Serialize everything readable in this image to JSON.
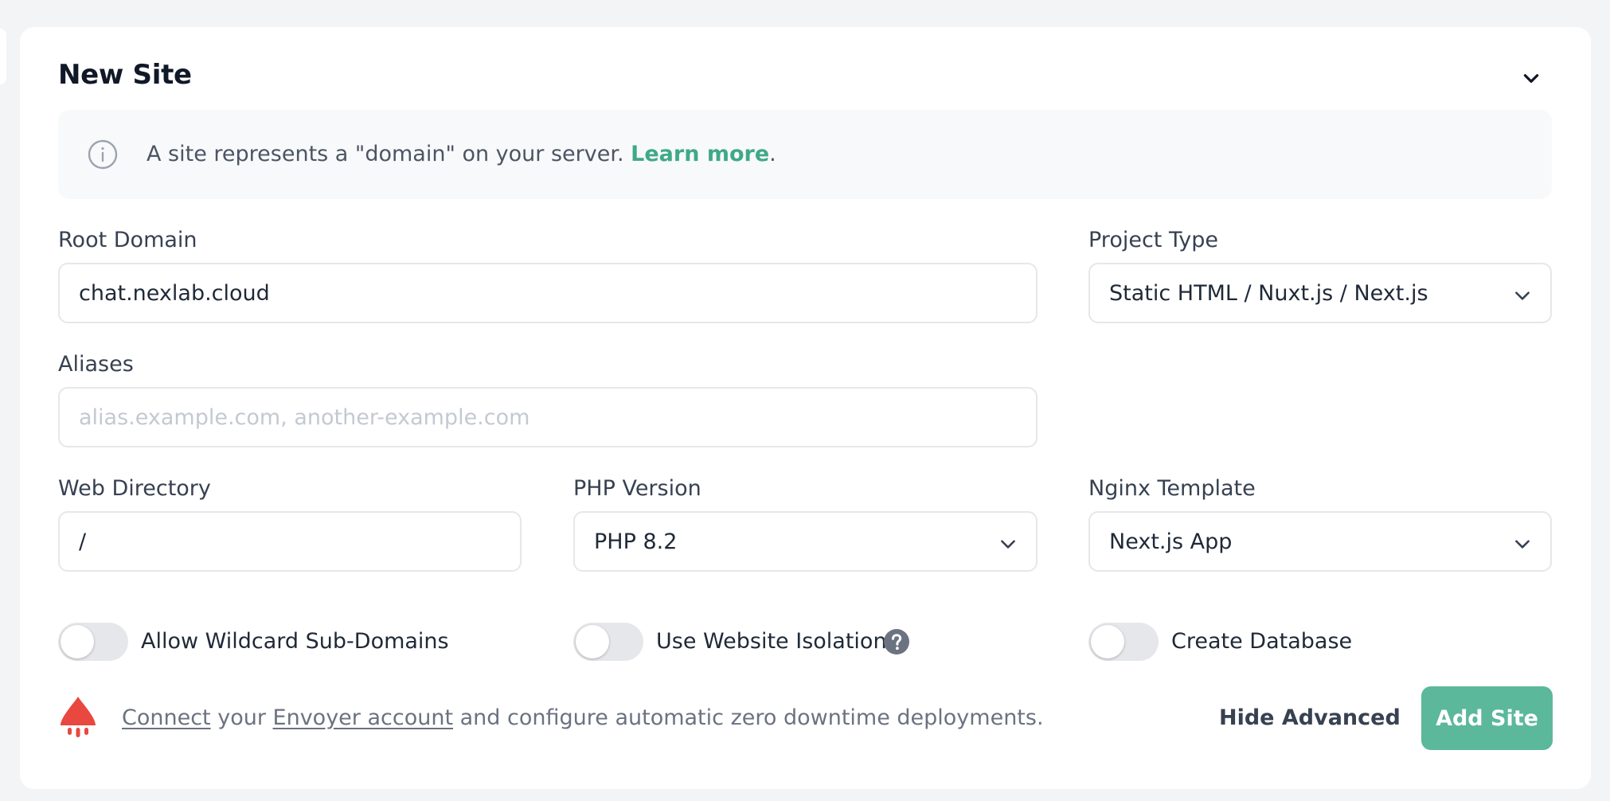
{
  "form": {
    "title": "New Site",
    "info": {
      "text": "A site represents a \"domain\" on your server.",
      "link": "Learn more",
      "period": "."
    },
    "root_domain": {
      "label": "Root Domain",
      "value": "chat.nexlab.cloud"
    },
    "project_type": {
      "label": "Project Type",
      "value": "Static HTML / Nuxt.js / Next.js"
    },
    "aliases": {
      "label": "Aliases",
      "value": "",
      "placeholder": "alias.example.com, another-example.com"
    },
    "web_directory": {
      "label": "Web Directory",
      "value": "/"
    },
    "php_version": {
      "label": "PHP Version",
      "value": "PHP 8.2"
    },
    "nginx_template": {
      "label": "Nginx Template",
      "value": "Next.js App"
    },
    "toggles": {
      "wildcard": {
        "label": "Allow Wildcard Sub-Domains",
        "on": false
      },
      "isolation": {
        "label": "Use Website Isolation",
        "on": false
      },
      "database": {
        "label": "Create Database",
        "on": false
      }
    },
    "footer": {
      "connect": "Connect",
      "your": " your ",
      "envoyer_account": "Envoyer account",
      "rest": " and configure automatic zero downtime deployments."
    },
    "hide_advanced": "Hide Advanced",
    "submit": "Add Site"
  },
  "icons": {
    "info": "info-circle-icon",
    "collapse": "chevron-down-icon",
    "select": "chevron-down-icon",
    "help": "question-circle-icon",
    "envoyer": "envoyer-logo"
  },
  "colors": {
    "accent": "#3fa987",
    "button": "#5cb89a",
    "envoyer": "#e8483f",
    "toggle_off": "#e5e7eb",
    "background": "#f3f4f6"
  }
}
